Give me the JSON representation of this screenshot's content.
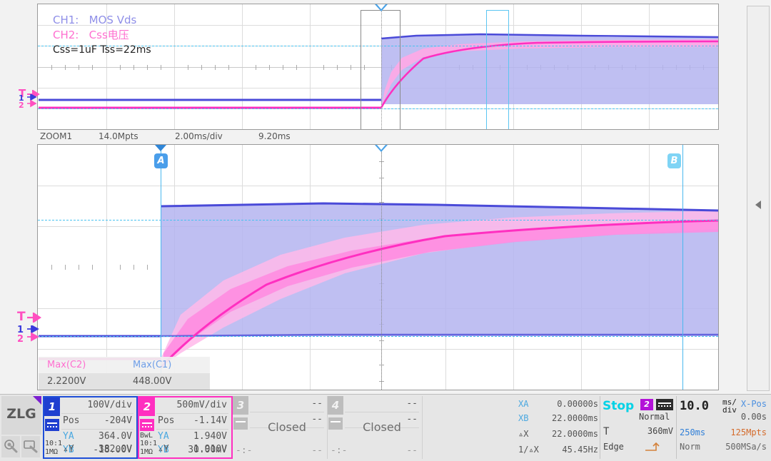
{
  "legend": {
    "ch1_label": "CH1:",
    "ch1_name": "MOS Vds",
    "ch2_label": "CH2:",
    "ch2_name": "Css电压",
    "note": "Css=1uF  Tss=22ms"
  },
  "zoom_bar": {
    "title": "ZOOM1",
    "memory": "14.0Mpts",
    "timebase": "2.00ms/div",
    "position": "9.20ms"
  },
  "cursors": {
    "a_label": "A",
    "b_label": "B"
  },
  "measurements": {
    "items": [
      {
        "name": "Max(C2)",
        "value": "2.2200V",
        "color": "#ff6fd0"
      },
      {
        "name": "Max(C1)",
        "value": "448.00V",
        "color": "#6f9fe8"
      }
    ]
  },
  "edge_markers": {
    "trigger": "T",
    "ch1": "1",
    "ch2": "2"
  },
  "statusbar": {
    "logo": "ZLG",
    "channels": [
      {
        "id": "1",
        "scale": "100V/div",
        "pos_label": "Pos",
        "pos_value": "-204V",
        "ya_label": "YA",
        "ya_value": "364.0V",
        "yb_label": "YB",
        "yb_value": "-18.00V",
        "dy_label": "▵Y",
        "dy_value": "382.0V",
        "probe": "10:1",
        "impedance": "1MΩ",
        "bandwidth": "",
        "closed": false
      },
      {
        "id": "2",
        "scale": "500mV/div",
        "pos_label": "Pos",
        "pos_value": "-1.14V",
        "ya_label": "YA",
        "ya_value": "1.940V",
        "yb_label": "YB",
        "yb_value": "30.00mV",
        "dy_label": "▵Y",
        "dy_value": "1.910V",
        "probe": "10:1",
        "impedance": "1MΩ",
        "bandwidth": "BwL",
        "closed": false
      },
      {
        "id": "3",
        "scale": "--",
        "pos_label": "",
        "pos_value": "--",
        "ya_label": "",
        "ya_value": "",
        "yb_label": "",
        "yb_value": "",
        "dy_label": "-:-",
        "dy_value": "--",
        "probe": "",
        "impedance": "",
        "bandwidth": "",
        "closed": true,
        "closed_label": "Closed"
      },
      {
        "id": "4",
        "scale": "--",
        "pos_label": "",
        "pos_value": "--",
        "ya_label": "",
        "ya_value": "",
        "yb_label": "",
        "yb_value": "",
        "dy_label": "-:-",
        "dy_value": "--",
        "probe": "",
        "impedance": "",
        "bandwidth": "",
        "closed": true,
        "closed_label": "Closed"
      }
    ],
    "cursor_readout": [
      {
        "label": "XA",
        "value": "0.00000s"
      },
      {
        "label": "XB",
        "value": "22.0000ms"
      },
      {
        "label": "▵X",
        "value": "22.0000ms"
      },
      {
        "label": "1/▵X",
        "value": "45.45Hz"
      }
    ],
    "trigger": {
      "run_state": "Stop",
      "source": "2",
      "mode": "Normal",
      "t_symbol": "T",
      "level": "360mV",
      "type": "Edge"
    },
    "timebase": {
      "value": "10.0",
      "unit_top": "ms/",
      "unit_bottom": "div",
      "xpos_label": "X-Pos",
      "xpos_value": "0.00s",
      "window": "250ms",
      "memory": "125Mpts",
      "acq_mode": "Norm",
      "sample_rate": "500MSa/s"
    }
  },
  "colors": {
    "ch1": "#5b5bdc",
    "ch1_fill": "#b4b4f0",
    "ch2": "#ff2fc0",
    "ch2_fill": "#ffa8e6",
    "cursor": "#4ab8ef",
    "accent_purple": "#7b1fd0"
  }
}
